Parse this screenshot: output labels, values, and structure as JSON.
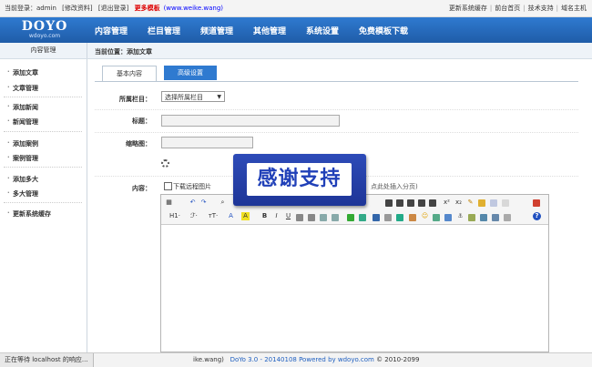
{
  "topbar": {
    "user_label": "当前登录：admin",
    "edit_profile": "[修改资料]",
    "logout": "[退出登录]",
    "promo": "更多模板",
    "promo_url": "(www.weike.wang)",
    "links": [
      "更新系统缓存",
      "前台首页",
      "技术支持",
      "域名主机"
    ]
  },
  "logo": {
    "name": "DOYO",
    "site": "wdoyo.com"
  },
  "nav": {
    "items": [
      "内容管理",
      "栏目管理",
      "频道管理",
      "其他管理",
      "系统设置",
      "免费模板下载"
    ]
  },
  "sidebar": {
    "title": "内容管理",
    "items": [
      "添加文章",
      "文章管理",
      "添加新闻",
      "新闻管理",
      "添加案例",
      "案例管理",
      "添加多大",
      "多大管理",
      "更新系统缓存"
    ]
  },
  "breadcrumb": "当前位置：添加文章",
  "tabs": [
    "基本内容",
    "高级设置"
  ],
  "form": {
    "category_label": "所属栏目：",
    "category_value": "选择所属栏目",
    "title_label": "标题：",
    "thumb_label": "缩略图：",
    "content_label": "内容：",
    "remote_image_label": "下载远程图片",
    "page_break_hint": "点此处插入分页)"
  },
  "toolbar": {
    "heading": "H1·",
    "font_family": "ℱ·",
    "font_size": "тT·",
    "bold": "B",
    "italic": "I",
    "underline": "U",
    "superscript": "x²",
    "subscript": "x₂",
    "undo": "↶",
    "redo": "↷",
    "help": "?"
  },
  "overlay": {
    "text": "感谢支持"
  },
  "footer": {
    "status": "正在等待 localhost 的响应...",
    "url_tail": "ike.wang)",
    "product": "DoYo 3.0 - 20140108 Powered by",
    "site": "wdoyo.com",
    "copyright": "© 2010-2099"
  },
  "colors": {
    "nav_blue": "#2f7ad0",
    "promo_red": "#dd0000",
    "overlay_blue": "#2040b8"
  }
}
